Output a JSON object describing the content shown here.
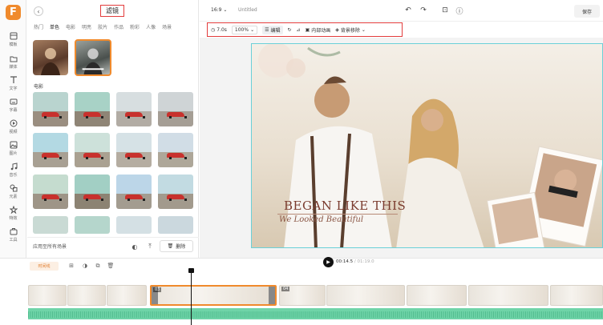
{
  "app": {
    "logo_letter": "F"
  },
  "sidebar": {
    "items": [
      {
        "label": "模板",
        "icon": "template-icon"
      },
      {
        "label": "媒体",
        "icon": "media-icon"
      },
      {
        "label": "文字",
        "icon": "text-icon"
      },
      {
        "label": "字幕",
        "icon": "subtitle-icon"
      },
      {
        "label": "视频",
        "icon": "video-icon"
      },
      {
        "label": "图片",
        "icon": "image-icon"
      },
      {
        "label": "音乐",
        "icon": "music-icon"
      },
      {
        "label": "元素",
        "icon": "elements-icon"
      },
      {
        "label": "特效",
        "icon": "effects-icon"
      },
      {
        "label": "工具",
        "icon": "tools-icon"
      }
    ]
  },
  "panel": {
    "title": "滤镜",
    "tabs": [
      "热门",
      "单色",
      "电影",
      "明亮",
      "胶片",
      "作品",
      "粉彩",
      "人像",
      "场景"
    ],
    "active_tab": "单色",
    "section_label": "电影",
    "apply_all": "应用至所有场景",
    "delete_label": "删除"
  },
  "topbar": {
    "ratio": "16:9",
    "doc_title": "Untitled",
    "save_label": "保存"
  },
  "toolbar": {
    "duration": "7.0s",
    "zoom": "100%",
    "adjust_label": "编辑",
    "inner_animation": "内部动画",
    "remove_bg": "背景移除"
  },
  "video": {
    "headline": "BEGAN LIKE THIS",
    "subline": "We Looked Beautiful"
  },
  "timeline": {
    "tag": "时间线",
    "current_time": "00:14.5",
    "total_time": "01:19.0",
    "clips": [
      {
        "no": ""
      },
      {
        "no": ""
      },
      {
        "no": ""
      },
      {
        "no": "03"
      },
      {
        "no": "04"
      },
      {
        "no": ""
      },
      {
        "no": ""
      },
      {
        "no": ""
      },
      {
        "no": ""
      }
    ]
  },
  "colors": {
    "accent": "#f08a2c",
    "highlight_border": "#e23c3c",
    "audio_track": "#6fd4a8",
    "canvas_outline": "#6ad0d8"
  }
}
